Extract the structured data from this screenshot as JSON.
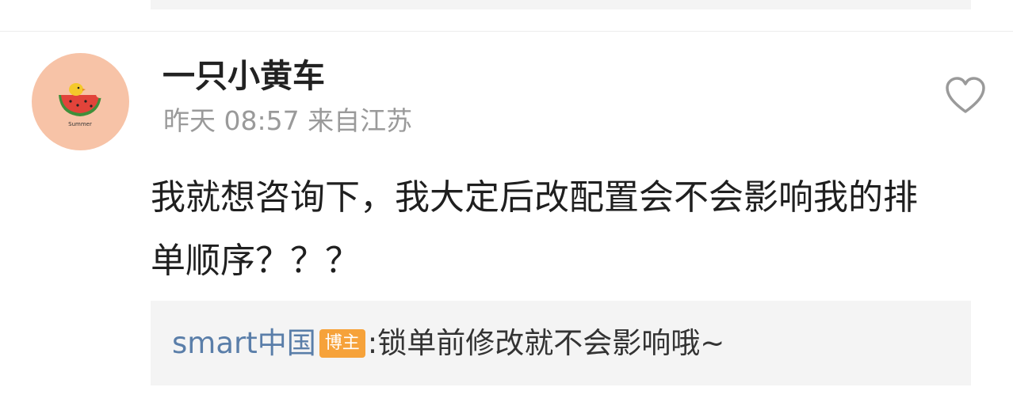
{
  "comment": {
    "username": "一只小黄车",
    "meta": "昨天 08:57 来自江苏",
    "text": "我就想咨询下，我大定后改配置会不会影响我的排单顺序？？？",
    "avatar_caption": "Summer",
    "reply": {
      "author": "smart中国",
      "badge": "博主",
      "separator": ":",
      "text": "锁单前修改就不会影响哦~"
    }
  },
  "colors": {
    "avatar_bg": "#f7c3a7",
    "author_link": "#5a7ea9",
    "badge_bg": "#f6a23a"
  },
  "icons": {
    "like": "heart-outline-icon"
  }
}
